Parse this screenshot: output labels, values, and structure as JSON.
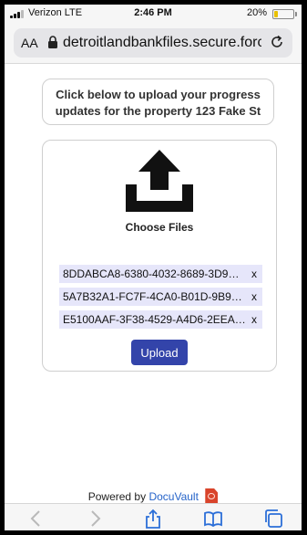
{
  "status_bar": {
    "carrier": "Verizon LTE",
    "time": "2:46 PM",
    "battery": "20%",
    "battery_level": 0.2
  },
  "browser": {
    "text_size_label": "AA",
    "url": "detroitlandbankfiles.secure.force.com"
  },
  "page": {
    "note_line1": "Click below to upload your progress",
    "note_line2": "updates for the property 123 Fake St",
    "upload_icon": "upload-icon",
    "choose_files_label": "Choose Files",
    "files": [
      {
        "name": "8DDABCA8-6380-4032-8689-3D9…",
        "remove": "x"
      },
      {
        "name": "5A7B32A1-FC7F-4CA0-B01D-9B9…",
        "remove": "x"
      },
      {
        "name": "E5100AAF-3F38-4529-A4D6-2EEA…",
        "remove": "x"
      }
    ],
    "upload_button": "Upload",
    "powered_by": "Powered by",
    "brand": "DocuVault"
  },
  "colors": {
    "accent": "#3344aa",
    "file_bg": "#e6e6fa",
    "link": "#2563c9"
  },
  "toolbar_icons": [
    "back-icon",
    "forward-icon",
    "share-icon",
    "bookmarks-icon",
    "tabs-icon"
  ]
}
